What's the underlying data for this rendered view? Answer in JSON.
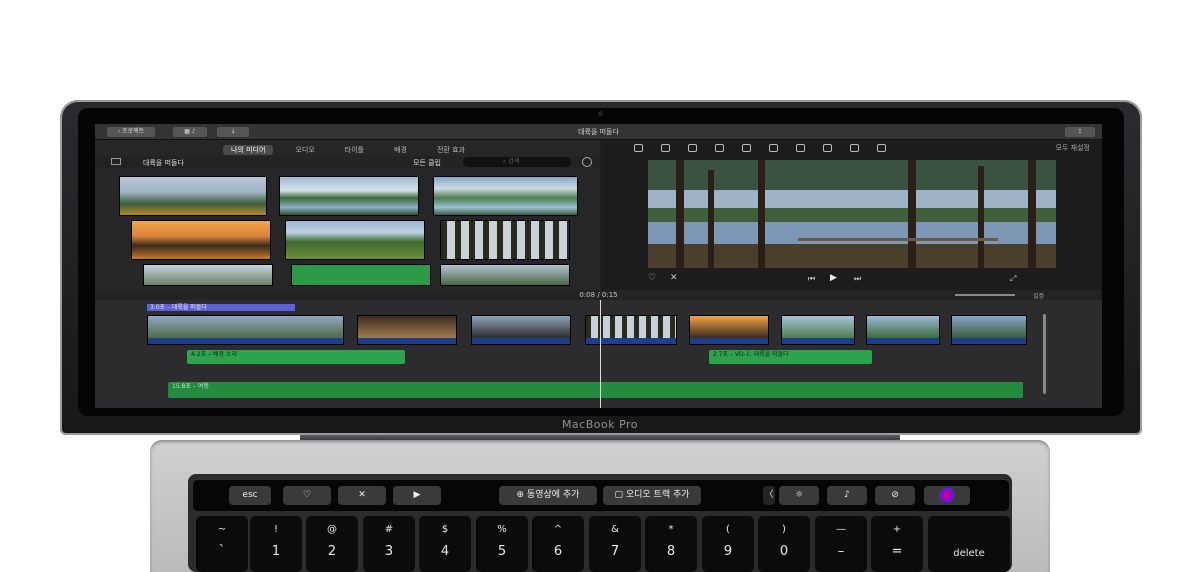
{
  "device": {
    "brand": "MacBook Pro"
  },
  "app": {
    "back_label": "프로젝트",
    "title": "대륙을 떠돌다",
    "tabs": [
      "나의 미디어",
      "오디오",
      "타이틀",
      "배경",
      "전환 효과"
    ],
    "library_title": "대륙을 떠돌다",
    "all_clips_label": "모든 클립",
    "search_placeholder": "검색",
    "reset_label": "모두 재설정",
    "timecode": "0:08 / 0:15",
    "settings_label": "설정",
    "title_clip_label": "3.0초 – 대륙을 떠돌다",
    "audio_clip_1": "4.2초 – 배경 소리",
    "audio_clip_2": "2.7초 – VO-1: 대륙을 떠돌다",
    "music_clip": "15.8초 – 여행"
  },
  "touchbar": {
    "esc": "esc",
    "add_movie": "동영상에 추가",
    "add_audio": "오디오 트랙 추가",
    "icons": [
      "heart-icon",
      "reject-icon",
      "play-icon",
      "chevron-left-icon",
      "brightness-icon",
      "volume-icon",
      "mute-icon",
      "siri-icon"
    ]
  },
  "keyboard": {
    "keys": [
      {
        "top": "~",
        "bottom": "`"
      },
      {
        "top": "!",
        "bottom": "1"
      },
      {
        "top": "@",
        "bottom": "2"
      },
      {
        "top": "#",
        "bottom": "3"
      },
      {
        "top": "$",
        "bottom": "4"
      },
      {
        "top": "%",
        "bottom": "5"
      },
      {
        "top": "^",
        "bottom": "6"
      },
      {
        "top": "&",
        "bottom": "7"
      },
      {
        "top": "*",
        "bottom": "8"
      },
      {
        "top": "(",
        "bottom": "9"
      },
      {
        "top": ")",
        "bottom": "0"
      },
      {
        "top": "—",
        "bottom": "–"
      },
      {
        "top": "+",
        "bottom": "="
      }
    ],
    "delete": "delete"
  }
}
